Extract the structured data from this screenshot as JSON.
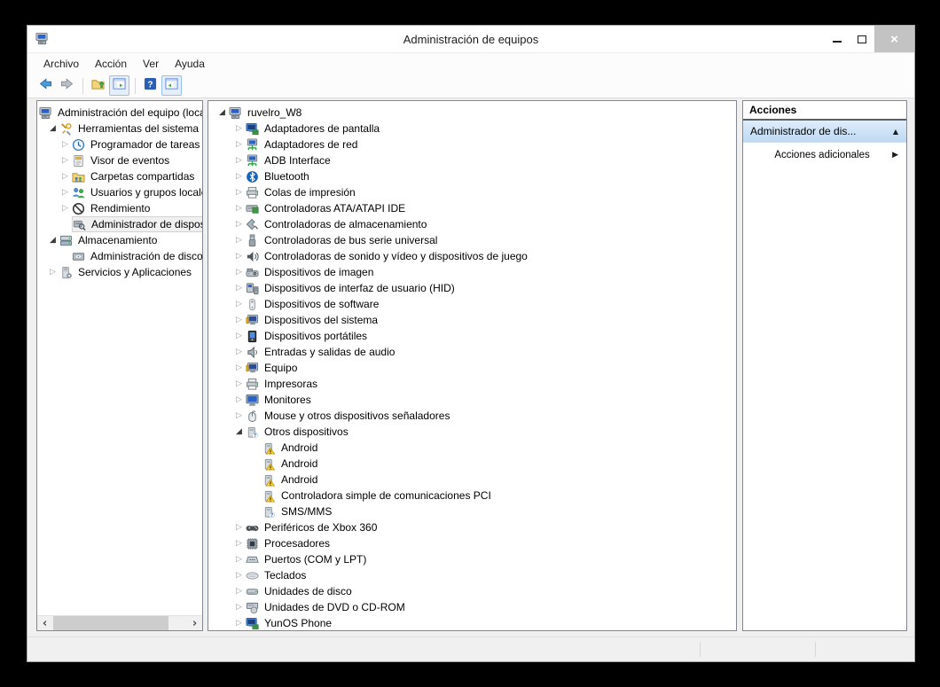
{
  "window": {
    "title": "Administración de equipos",
    "controls": [
      "minimize",
      "maximize",
      "close"
    ]
  },
  "icons": {
    "app": "computer-management",
    "expanded_glyph": "◢",
    "collapsed_glyph": "▷",
    "scroll_left_glyph": "‹",
    "scroll_right_glyph": "›",
    "close_glyph": "×",
    "collapse_arrow_glyph": "▲",
    "submenu_arrow_glyph": "▶"
  },
  "menu": {
    "items": [
      "Archivo",
      "Acción",
      "Ver",
      "Ayuda"
    ]
  },
  "toolbar": {
    "buttons": [
      {
        "icon": "back-arrow",
        "toggled": false
      },
      {
        "icon": "forward-arrow",
        "toggled": false
      },
      {
        "icon": "separator"
      },
      {
        "icon": "up-level",
        "toggled": false
      },
      {
        "icon": "console-tree-toggle",
        "toggled": true
      },
      {
        "icon": "separator"
      },
      {
        "icon": "help",
        "toggled": false
      },
      {
        "icon": "action-pane-toggle",
        "toggled": true
      }
    ]
  },
  "console_tree": {
    "items": [
      {
        "label": "Administración del equipo (local)",
        "icon": "computer-management",
        "expander": "none",
        "level": 0,
        "slot": false
      },
      {
        "label": "Herramientas del sistema",
        "icon": "system-tools",
        "expander": "expanded",
        "level": 1
      },
      {
        "label": "Programador de tareas",
        "icon": "task-scheduler",
        "expander": "collapsed",
        "level": 2
      },
      {
        "label": "Visor de eventos",
        "icon": "event-viewer",
        "expander": "collapsed",
        "level": 2
      },
      {
        "label": "Carpetas compartidas",
        "icon": "shared-folders",
        "expander": "collapsed",
        "level": 2
      },
      {
        "label": "Usuarios y grupos locales",
        "icon": "local-users",
        "expander": "collapsed",
        "level": 2
      },
      {
        "label": "Rendimiento",
        "icon": "performance",
        "expander": "collapsed",
        "level": 2
      },
      {
        "label": "Administrador de dispositivos",
        "icon": "device-manager",
        "expander": "none",
        "level": 2,
        "selected": true
      },
      {
        "label": "Almacenamiento",
        "icon": "storage",
        "expander": "expanded",
        "level": 1
      },
      {
        "label": "Administración de discos",
        "icon": "disk-management",
        "expander": "none",
        "level": 2
      },
      {
        "label": "Servicios y Aplicaciones",
        "icon": "services",
        "expander": "collapsed",
        "level": 1
      }
    ]
  },
  "device_tree": {
    "items": [
      {
        "label": "ruvelro_W8",
        "icon": "computer-management",
        "expander": "expanded",
        "level": 0
      },
      {
        "label": "Adaptadores de pantalla",
        "icon": "display-adapter",
        "expander": "collapsed",
        "level": 1
      },
      {
        "label": "Adaptadores de red",
        "icon": "network-adapter",
        "expander": "collapsed",
        "level": 1
      },
      {
        "label": "ADB Interface",
        "icon": "network-adapter",
        "expander": "collapsed",
        "level": 1
      },
      {
        "label": "Bluetooth",
        "icon": "bluetooth",
        "expander": "collapsed",
        "level": 1
      },
      {
        "label": "Colas de impresión",
        "icon": "printer",
        "expander": "collapsed",
        "level": 1
      },
      {
        "label": "Controladoras ATA/ATAPI IDE",
        "icon": "ide-controller",
        "expander": "collapsed",
        "level": 1
      },
      {
        "label": "Controladoras de almacenamiento",
        "icon": "storage-controller",
        "expander": "collapsed",
        "level": 1
      },
      {
        "label": "Controladoras de bus serie universal",
        "icon": "usb-controller",
        "expander": "collapsed",
        "level": 1
      },
      {
        "label": "Controladoras de sonido y vídeo y dispositivos de juego",
        "icon": "sound-controller",
        "expander": "collapsed",
        "level": 1
      },
      {
        "label": "Dispositivos de imagen",
        "icon": "imaging-device",
        "expander": "collapsed",
        "level": 1
      },
      {
        "label": "Dispositivos de interfaz de usuario (HID)",
        "icon": "hid-device",
        "expander": "collapsed",
        "level": 1
      },
      {
        "label": "Dispositivos de software",
        "icon": "software-device",
        "expander": "collapsed",
        "level": 1
      },
      {
        "label": "Dispositivos del sistema",
        "icon": "system-device",
        "expander": "collapsed",
        "level": 1
      },
      {
        "label": "Dispositivos portátiles",
        "icon": "portable-device",
        "expander": "collapsed",
        "level": 1
      },
      {
        "label": "Entradas y salidas de audio",
        "icon": "audio-io",
        "expander": "collapsed",
        "level": 1
      },
      {
        "label": "Equipo",
        "icon": "system-device",
        "expander": "collapsed",
        "level": 1
      },
      {
        "label": "Impresoras",
        "icon": "printer",
        "expander": "collapsed",
        "level": 1
      },
      {
        "label": "Monitores",
        "icon": "monitor",
        "expander": "collapsed",
        "level": 1
      },
      {
        "label": "Mouse y otros dispositivos señaladores",
        "icon": "mouse",
        "expander": "collapsed",
        "level": 1
      },
      {
        "label": "Otros dispositivos",
        "icon": "question-device",
        "expander": "expanded",
        "level": 1
      },
      {
        "label": "Android",
        "icon": "warning-device",
        "expander": "none",
        "level": 2
      },
      {
        "label": "Android",
        "icon": "warning-device",
        "expander": "none",
        "level": 2
      },
      {
        "label": "Android",
        "icon": "warning-device",
        "expander": "none",
        "level": 2
      },
      {
        "label": "Controladora simple de comunicaciones PCI",
        "icon": "warning-device",
        "expander": "none",
        "level": 2
      },
      {
        "label": "SMS/MMS",
        "icon": "question-device",
        "expander": "none",
        "level": 2
      },
      {
        "label": "Periféricos de Xbox 360",
        "icon": "game-controller",
        "expander": "collapsed",
        "level": 1
      },
      {
        "label": "Procesadores",
        "icon": "processor",
        "expander": "collapsed",
        "level": 1
      },
      {
        "label": "Puertos (COM y LPT)",
        "icon": "ports",
        "expander": "collapsed",
        "level": 1
      },
      {
        "label": "Teclados",
        "icon": "keyboard",
        "expander": "collapsed",
        "level": 1
      },
      {
        "label": "Unidades de disco",
        "icon": "disk-drive",
        "expander": "collapsed",
        "level": 1
      },
      {
        "label": "Unidades de DVD o CD-ROM",
        "icon": "dvd-drive",
        "expander": "collapsed",
        "level": 1
      },
      {
        "label": "YunOS Phone",
        "icon": "display-adapter",
        "expander": "collapsed",
        "level": 1
      }
    ]
  },
  "actions_panel": {
    "header": "Acciones",
    "group_label": "Administrador de dis...",
    "additional_label": "Acciones adicionales"
  },
  "colors": {
    "toolbar_toggle_bg": "#e4effb",
    "toolbar_toggle_border": "#98c1e8",
    "actions_group_top": "#dfedfb",
    "actions_group_bottom": "#bed9f3",
    "warning_yellow": "#ffd02e",
    "bluetooth_blue": "#1464c0",
    "close_button_bg": "#c3c3c3"
  }
}
